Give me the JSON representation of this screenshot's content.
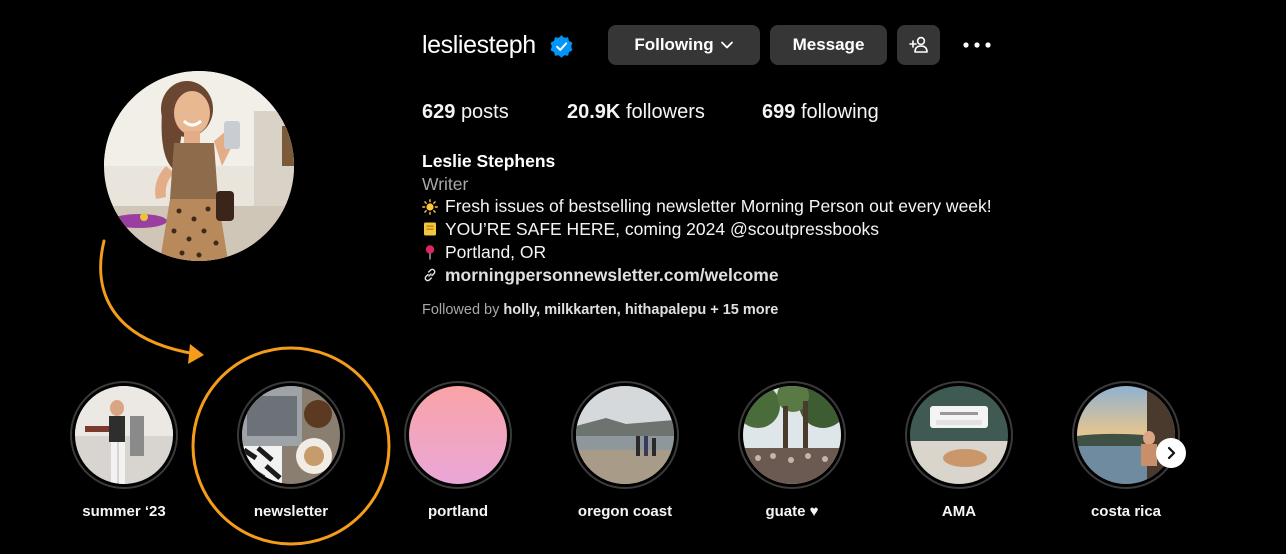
{
  "profile": {
    "username": "lesliesteph",
    "verified_icon": "verified-badge-icon",
    "buttons": {
      "following": "Following",
      "message": "Message",
      "add_user_icon": "add-user-icon",
      "more_icon": "more-options-icon"
    },
    "stats": {
      "posts_count": "629",
      "posts_label": "posts",
      "followers_count": "20.9K",
      "followers_label": "followers",
      "following_count": "699",
      "following_label": "following"
    },
    "bio": {
      "name": "Leslie Stephens",
      "category": "Writer",
      "line1": "Fresh issues of bestselling newsletter Morning Person out every week!",
      "line2": "YOU’RE SAFE HERE, coming 2024 @scoutpressbooks",
      "line3": "Portland, OR",
      "link": "morningpersonnewsletter.com/welcome"
    },
    "followed_by": {
      "prefix": "Followed by",
      "names": "holly, milkkarten, hithapalepu",
      "suffix": "+ 15 more"
    }
  },
  "highlights": [
    {
      "label": "summer ‘23"
    },
    {
      "label": "newsletter"
    },
    {
      "label": "portland"
    },
    {
      "label": "oregon coast"
    },
    {
      "label": "guate ♥"
    },
    {
      "label": "AMA"
    },
    {
      "label": "costa rica"
    }
  ],
  "colors": {
    "annotation": "#f59c1a",
    "verified": "#0095f6",
    "button_bg": "#363636"
  }
}
